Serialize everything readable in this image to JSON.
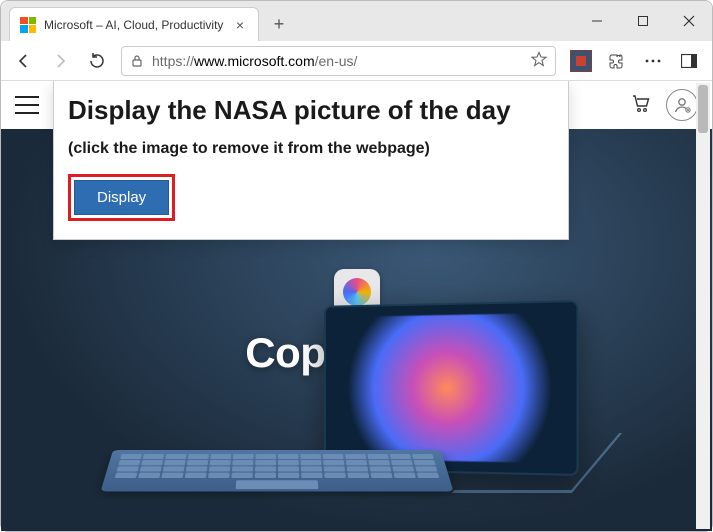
{
  "browser": {
    "tab_title": "Microsoft – AI, Cloud, Productivity",
    "url_https": "https://",
    "url_host": "www.microsoft.com",
    "url_path": "/en-us/"
  },
  "popup": {
    "heading": "Display the NASA picture of the day",
    "subheading": "(click the image to remove it from the webpage)",
    "button_label": "Display"
  },
  "hero": {
    "title": "Copilot+PC"
  }
}
